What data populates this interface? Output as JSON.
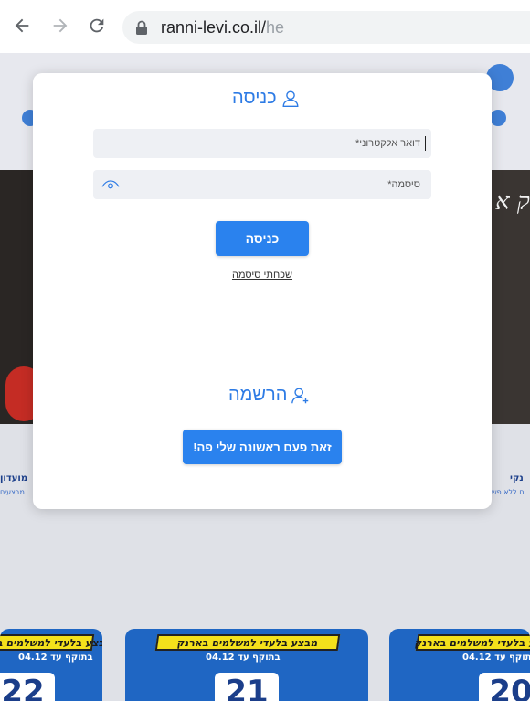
{
  "browser": {
    "url_main": "ranni-levi.co.il/",
    "url_suffix": "he"
  },
  "icons": {
    "back": "back-arrow-icon",
    "forward": "forward-arrow-icon",
    "reload": "reload-icon",
    "lock": "lock-icon",
    "user": "user-icon",
    "user_add": "user-add-icon",
    "eye": "eye-icon"
  },
  "colors": {
    "accent": "#2a82ee",
    "title_blue": "#2d7be5",
    "field_bg": "#eef0f4"
  },
  "login": {
    "title": "כניסה",
    "email_placeholder": "דואר אלקטרוני*",
    "password_placeholder": "סיסמה*",
    "submit_label": "כניסה",
    "forgot_label": "שכחתי סיסמה"
  },
  "register": {
    "title": "הרשמה",
    "first_time_label": "זאת פעם ראשונה שלי פה!"
  },
  "background": {
    "left_caption": "מועדון",
    "left_sub": "מבצעים",
    "right_caption": "נקי",
    "right_sub": "ם ללא פש",
    "banner_script": "ק א",
    "promo_strip": "מבצע בלעדי למשלמים בארנק",
    "promo_valid": "בתוקף עד 04.12",
    "promo_numbers": [
      "22",
      "21",
      "20"
    ]
  }
}
